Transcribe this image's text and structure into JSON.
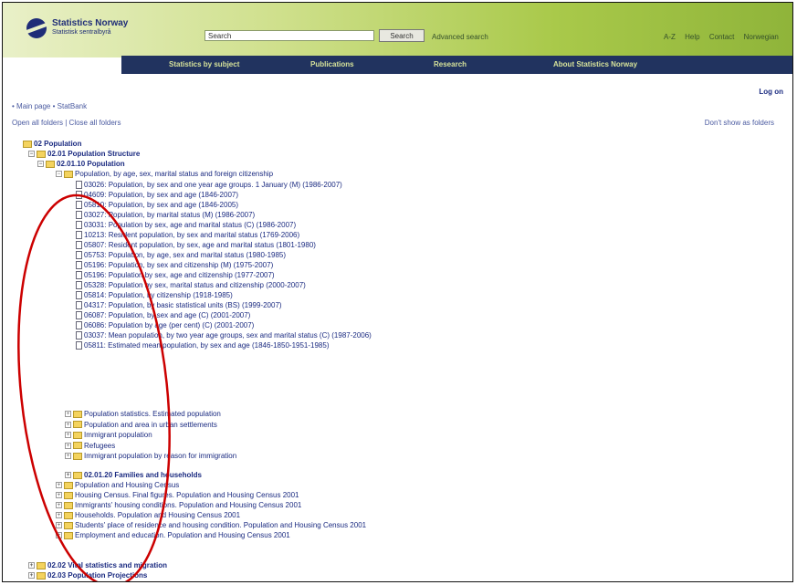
{
  "header": {
    "logo_name": "Statistics Norway",
    "logo_sub": "Statistisk sentralbyrå",
    "search_label": "Search",
    "search_button": "Search",
    "advanced_search": "Advanced search",
    "links": [
      "A-Z",
      "Help",
      "Contact",
      "Norwegian"
    ]
  },
  "nav": [
    "Statistics by subject",
    "Publications",
    "Research",
    "About Statistics Norway"
  ],
  "logon": "Log on",
  "breadcrumb": "• Main page • StatBank",
  "folder_controls": "Open all folders | Close all folders",
  "dont_show": "Don't show as folders",
  "tree": {
    "root": "02 Population",
    "sub1": "02.01 Population Structure",
    "sub2": "02.01.10 Population",
    "sub3": "Population, by age, sex, marital status and foreign citizenship",
    "tables": [
      "03026: Population, by sex and one year age groups. 1 January (M) (1986-2007)",
      "04609: Population, by sex and age (1846-2007)",
      "05810: Population, by sex and age (1846-2005)",
      "03027: Population, by marital status (M) (1986-2007)",
      "03031: Population by sex, age and marital status (C) (1986-2007)",
      "10213: Resident population, by sex and marital status (1769-2006)",
      "05807: Resident population, by sex, age and marital status (1801-1980)",
      "05753: Population, by age, sex and marital status (1980-1985)",
      "05196: Population, by sex and citizenship (M) (1975-2007)",
      "05196: Population by sex, age and citizenship (1977-2007)",
      "05328: Population by sex, marital status and citizenship (2000-2007)",
      "05814: Population, by citizenship (1918-1985)",
      "04317: Population, by basic statistical units (BS) (1999-2007)",
      "06087: Population, by sex and age (C) (2001-2007)",
      "06086: Population by age (per cent) (C) (2001-2007)",
      "03037: Mean population, by two year age groups, sex and marital status (C) (1987-2006)",
      "05811: Estimated mean population, by sex and age (1846-1850-1951-1985)"
    ],
    "groups": [
      "Population statistics. Estimated population",
      "Population and area in urban settlements",
      "Immigrant population",
      "Refugees",
      "Immigrant population by reason for immigration"
    ],
    "families": "02.01.20 Families and households",
    "families_items": [
      "Population and Housing Census",
      "Housing Census. Final figures. Population and Housing Census 2001",
      "Immigrants' housing conditions. Population and Housing Census 2001",
      "Households. Population and Housing Census 2001",
      "Students' place of residence and housing condition. Population and Housing Census 2001",
      "Employment and education. Population and Housing Census 2001"
    ],
    "vital": "02.02 Vital statistics and migration",
    "projections": "02.03 Population Projections"
  },
  "colors": {
    "nav_bg": "#21335f",
    "nav_text": "#d6e29a",
    "link": "#1a2a80",
    "oval": "#cc0000"
  }
}
